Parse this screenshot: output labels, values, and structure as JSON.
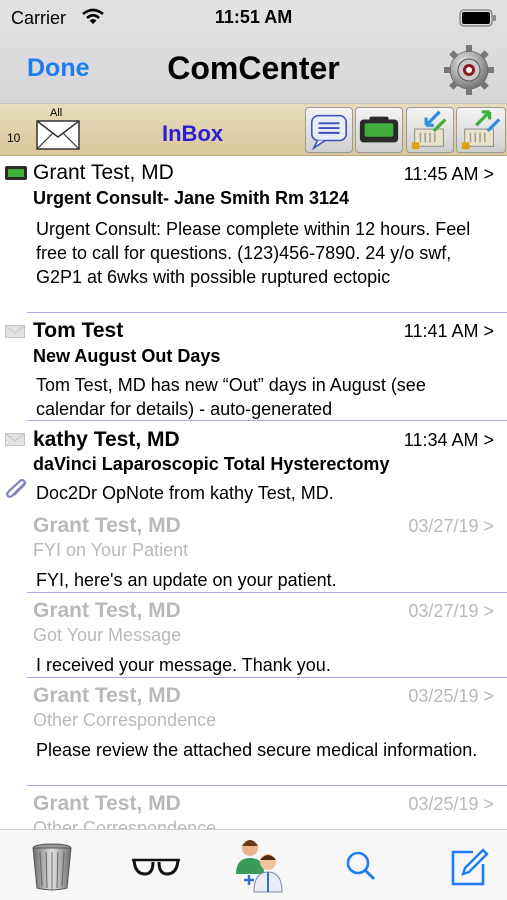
{
  "status": {
    "carrier": "Carrier",
    "time": "11:51 AM"
  },
  "nav": {
    "done_label": "Done",
    "title": "ComCenter"
  },
  "toolbar": {
    "count": "10",
    "all_label": "All",
    "folder_label": "InBox"
  },
  "messages": [
    {
      "sender": "Grant Test, MD",
      "time": "11:45 AM >",
      "subject": "Urgent Consult- Jane Smith Rm 3124",
      "preview": "Urgent Consult: Please complete within 12 hours. Feel free to call for questions. (123)456-7890. 24 y/o swf, G2P1 at 6wks with possible ruptured ectopic",
      "icon": "pager-icon",
      "read": false
    },
    {
      "sender": "Tom Test",
      "time": "11:41 AM >",
      "subject": "New August Out Days",
      "preview": "Tom Test, MD has new “Out” days in August (see calendar for details) - auto-generated",
      "icon": "envelope-icon",
      "read": false
    },
    {
      "sender": "kathy Test, MD",
      "time": "11:34 AM >",
      "subject": "daVinci Laparoscopic Total Hysterectomy",
      "preview": "Doc2Dr OpNote from kathy Test, MD.",
      "icon": "envelope-icon",
      "read": false,
      "attachment": "paperclip-icon"
    },
    {
      "sender": "Grant Test, MD",
      "time": "03/27/19 >",
      "subject": "FYI on Your Patient",
      "preview": "FYI, here's an update on your patient.",
      "read": true
    },
    {
      "sender": "Grant Test, MD",
      "time": "03/27/19 >",
      "subject": "Got Your Message",
      "preview": "I received your message. Thank you.",
      "read": true
    },
    {
      "sender": "Grant Test, MD",
      "time": "03/25/19 >",
      "subject": "Other Correspondence",
      "preview": "Please review the attached secure medical information.",
      "read": true
    },
    {
      "sender": "Grant Test, MD",
      "time": "03/25/19 >",
      "subject": "Other Correspondence",
      "preview": "",
      "read": true
    }
  ],
  "tabs": [
    "trash-icon",
    "glasses-icon",
    "doctors-icon",
    "search-icon",
    "compose-icon"
  ],
  "colors": {
    "accent": "#1e7cf2",
    "inbox": "#2a1fd8",
    "toolbar": "#e0d1ab",
    "read_text": "#b9b9b9",
    "divider": "#a7a7dd"
  }
}
